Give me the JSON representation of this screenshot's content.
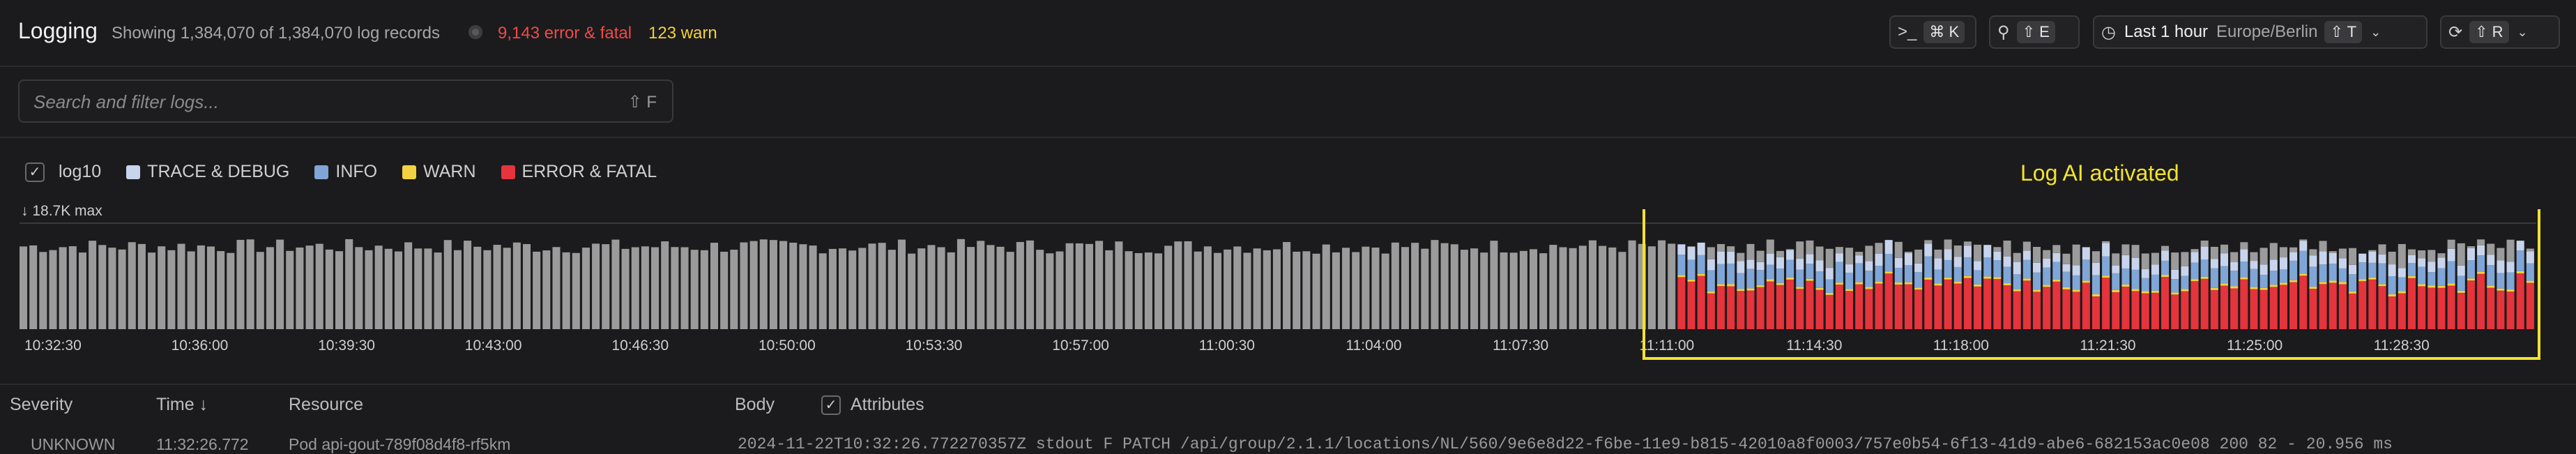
{
  "header": {
    "title": "Logging",
    "summary": "Showing 1,384,070 of 1,384,070 log records",
    "error_count": "9,143 error & fatal",
    "warn_count": "123 warn",
    "terminal_shortcut": "⌘ K",
    "explore_shortcut": "⇧ E",
    "time_range": "Last 1 hour",
    "timezone": "Europe/Berlin",
    "time_shortcut": "⇧ T",
    "refresh_shortcut": "⇧ R"
  },
  "search": {
    "placeholder": "Search and filter logs...",
    "shortcut": "⇧ F"
  },
  "legend": {
    "log10_label": "log10",
    "items": [
      {
        "label": "TRACE & DEBUG",
        "color": "#c7d4ec"
      },
      {
        "label": "INFO",
        "color": "#7fa6d6"
      },
      {
        "label": "WARN",
        "color": "#f1d33f"
      },
      {
        "label": "ERROR & FATAL",
        "color": "#e5343b"
      }
    ]
  },
  "annotation": "Log AI activated",
  "chart_data": {
    "type": "bar",
    "stacked": true,
    "log_scale": true,
    "max_label": "18.7K max",
    "x_tick_labels": [
      "10:32:30",
      "10:36:00",
      "10:39:30",
      "10:43:00",
      "10:46:30",
      "10:50:00",
      "10:53:30",
      "10:57:00",
      "11:00:30",
      "11:04:00",
      "11:07:30",
      "11:11:00",
      "11:14:30",
      "11:18:00",
      "11:21:30",
      "11:25:00",
      "11:28:30"
    ],
    "series": [
      {
        "name": "TRACE & DEBUG",
        "color": "#c7d4ec"
      },
      {
        "name": "INFO",
        "color": "#7fa6d6"
      },
      {
        "name": "WARN",
        "color": "#f1d33f"
      },
      {
        "name": "ERROR & FATAL",
        "color": "#e5343b"
      }
    ],
    "unclassified_color": "#9b9b9b",
    "highlight_color": "#f2e230"
  },
  "table": {
    "columns": [
      "Severity",
      "Time",
      "Resource",
      "Body",
      "Attributes"
    ],
    "first_row": {
      "severity": "UNKNOWN",
      "time": "11:32:26.772",
      "resource": "Pod api-gout-789f08d4f8-rf5km",
      "body": "2024-11-22T10:32:26.772270357Z stdout F PATCH /api/group/2.1.1/locations/NL/560/9e6e8d22-f6be-11e9-b815-42010a8f0003/757e0b54-6f13-41d9-abe6-682153ac0e08 200 82 - 20.956 ms"
    }
  }
}
